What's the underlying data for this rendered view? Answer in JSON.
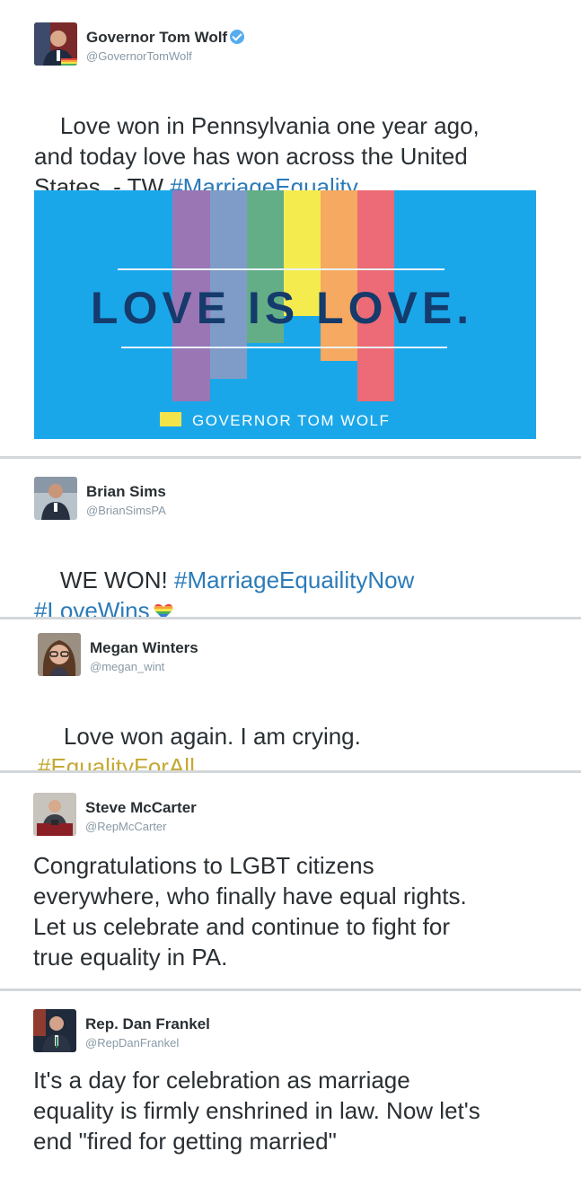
{
  "tweets": [
    {
      "name": "Governor Tom Wolf",
      "handle": "@GovernorTomWolf",
      "verified": true,
      "text_plain": "Love won in Pennsylvania one year ago,\nand today love has won across the United\nStates. - TW ",
      "hashtag": "#MarriageEquality",
      "avatar_icon": "portrait-avatar-icon",
      "image": {
        "headline": "LOVE IS LOVE.",
        "footer": "GOVERNOR TOM WOLF",
        "background": "#1aa7ea",
        "stripe_colors": [
          "#9a76b5",
          "#7f9cc8",
          "#63ae86",
          "#f4ec4e",
          "#f6a960",
          "#ec6b76"
        ]
      }
    },
    {
      "name": "Brian Sims",
      "handle": "@BrianSimsPA",
      "text_plain": "WE WON! ",
      "hashtag": "#MarriageEquailityNow",
      "hashtag2": "#LoveWins",
      "emoji": "rainbow-heart-icon",
      "avatar_icon": "portrait-avatar-icon"
    },
    {
      "name": "Megan Winters",
      "handle": "@megan_wint",
      "text_plain": "Love won again. I am crying.",
      "hashtag": "#EqualityForAll",
      "avatar_icon": "portrait-avatar-icon"
    },
    {
      "name": "Steve McCarter",
      "handle": "@RepMcCarter",
      "text_plain": "Congratulations to LGBT citizens\neverywhere, who finally have equal rights.\nLet us celebrate and continue to fight for\ntrue equality in PA.",
      "avatar_icon": "portrait-avatar-icon"
    },
    {
      "name": "Rep. Dan Frankel",
      "handle": "@RepDanFrankel",
      "text_plain": "It's a day for celebration as marriage\nequality is firmly enshrined in law. Now let's\nend \"fired for getting married\"",
      "avatar_icon": "portrait-avatar-icon"
    }
  ],
  "colors": {
    "hashtag_blue": "#2b7bb9",
    "hashtag_gold": "#c5a936",
    "handle_gray": "#8899a6",
    "divider": "#d4d7d9"
  }
}
